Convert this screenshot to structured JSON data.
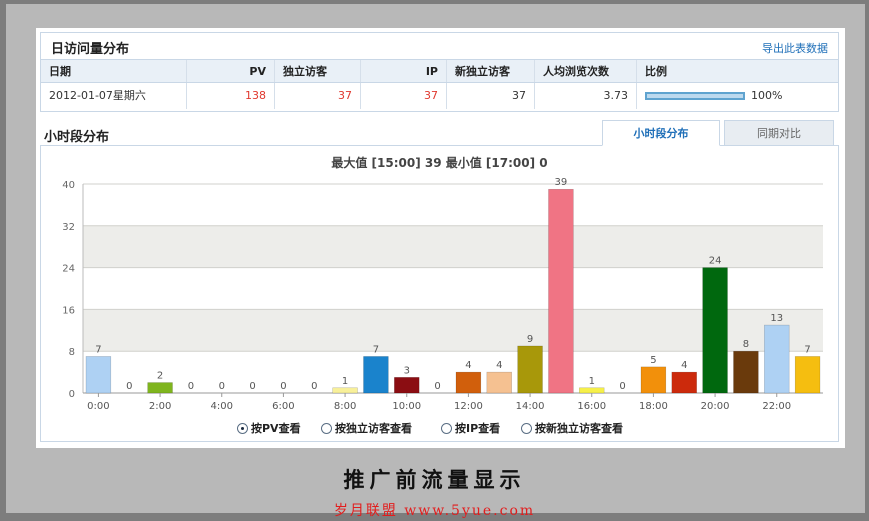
{
  "summary": {
    "title": "日访问量分布",
    "export_label": "导出此表数据",
    "columns": [
      "日期",
      "PV",
      "独立访客",
      "IP",
      "新独立访客",
      "人均浏览次数",
      "比例"
    ],
    "row": {
      "date": "2012-01-07星期六",
      "pv": "138",
      "uv": "37",
      "ip": "37",
      "new_uv": "37",
      "avg_views": "3.73",
      "ratio": "100%",
      "ratio_fill": 1.0
    }
  },
  "hourly": {
    "title": "小时段分布",
    "tabs": [
      "小时段分布",
      "同期对比"
    ],
    "active_tab": 0,
    "summary_text": "最大值 [15:00] 39   最小值 [17:00] 0",
    "radio_options": [
      "按PV查看",
      "按独立访客查看",
      "按IP查看",
      "按新独立访客查看"
    ],
    "selected_option": 0
  },
  "chart_data": {
    "type": "bar",
    "categories": [
      "0:00",
      "1:00",
      "2:00",
      "3:00",
      "4:00",
      "5:00",
      "6:00",
      "7:00",
      "8:00",
      "9:00",
      "10:00",
      "11:00",
      "12:00",
      "13:00",
      "14:00",
      "15:00",
      "16:00",
      "17:00",
      "18:00",
      "19:00",
      "20:00",
      "21:00",
      "22:00",
      "23:00"
    ],
    "x_tick_labels": [
      "0:00",
      "2:00",
      "4:00",
      "6:00",
      "8:00",
      "10:00",
      "12:00",
      "14:00",
      "16:00",
      "18:00",
      "20:00",
      "22:00"
    ],
    "values": [
      7,
      0,
      2,
      0,
      0,
      0,
      0,
      0,
      1,
      7,
      3,
      0,
      4,
      4,
      9,
      39,
      1,
      0,
      5,
      4,
      24,
      8,
      13,
      7
    ],
    "colors": [
      "#aed1f3",
      "#aed1f3",
      "#7fb51e",
      "#7fb51e",
      "#888888",
      "#888888",
      "#888888",
      "#888888",
      "#f8f09a",
      "#1a83cc",
      "#8b0d12",
      "#8b0d12",
      "#d15f0c",
      "#f5c191",
      "#a8980a",
      "#f07484",
      "#f6f04a",
      "#f6f04a",
      "#f2900b",
      "#cc2a0c",
      "#00680e",
      "#6a3a0c",
      "#aed1f3",
      "#f5be10"
    ],
    "y_ticks": [
      0,
      8,
      16,
      24,
      32,
      40
    ],
    "ylim": [
      0,
      40
    ],
    "grid": true
  },
  "caption": "推广前流量显示",
  "watermark": "岁月联盟  www.5yue.com"
}
